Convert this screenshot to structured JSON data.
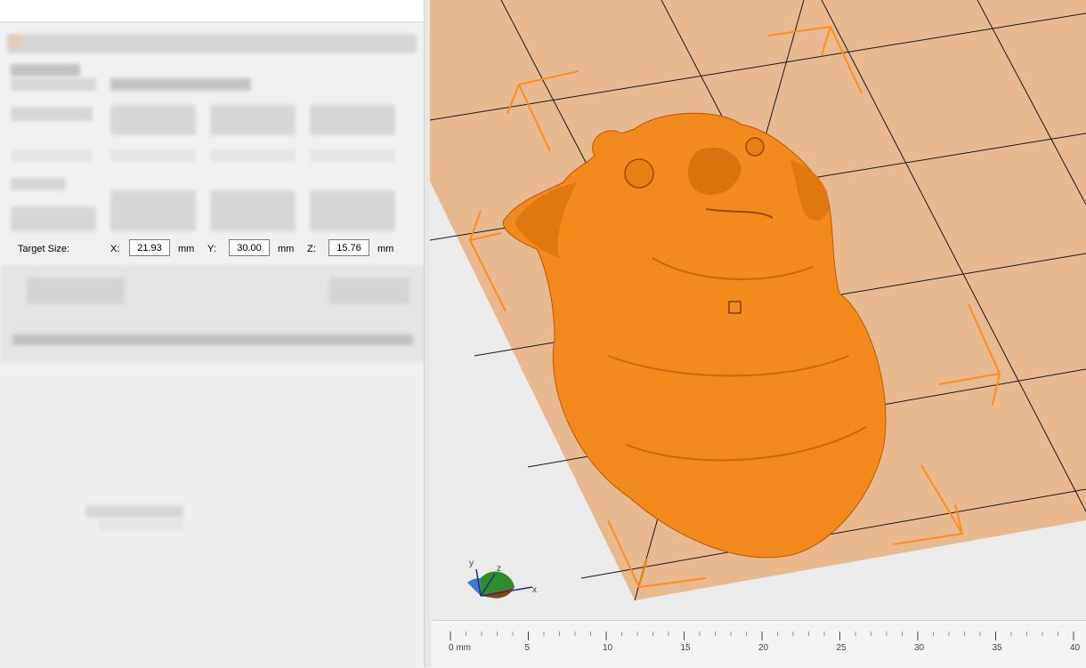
{
  "target_size": {
    "label": "Target Size:",
    "x_label": "X:",
    "x_value": "21.93",
    "y_label": "Y:",
    "y_value": "30.00",
    "z_label": "Z:",
    "z_value": "15.76",
    "unit": "mm"
  },
  "axis_gizmo": {
    "x": "x",
    "y": "y",
    "z": "z"
  },
  "ruler": {
    "ticks": [
      "0 mm",
      "5",
      "10",
      "15",
      "20",
      "25",
      "30",
      "35",
      "40"
    ]
  },
  "colors": {
    "bed": "#e8b88f",
    "model": "#f28a1e",
    "frame": "#ff8c1a"
  },
  "icons": [
    "axis-gizmo-icon",
    "pug-model-icon"
  ]
}
